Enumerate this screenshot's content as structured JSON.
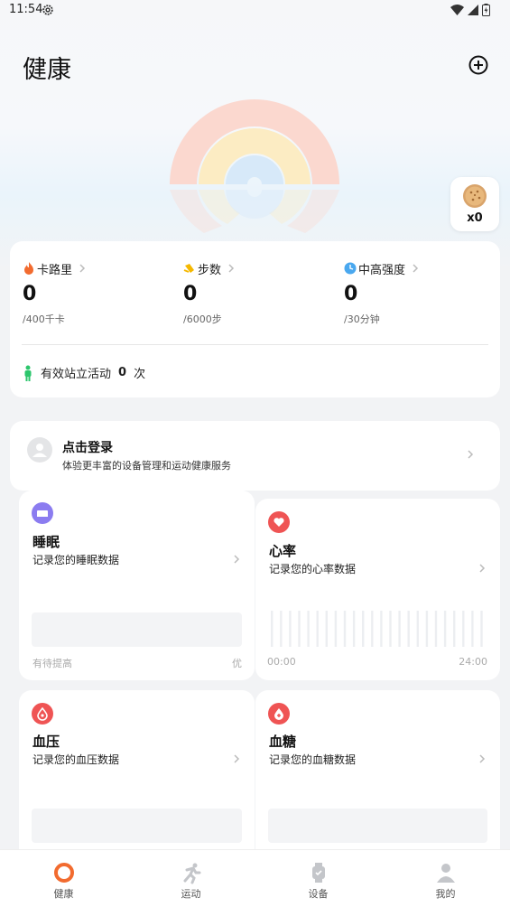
{
  "status_bar": {
    "time": "11:54"
  },
  "header": {
    "title": "健康"
  },
  "badge": {
    "count": "x0"
  },
  "stats": {
    "calories": {
      "label": "卡路里",
      "value": "0",
      "goal": "/400千卡"
    },
    "steps": {
      "label": "步数",
      "value": "0",
      "goal": "/6000步"
    },
    "intensity": {
      "label": "中高强度",
      "value": "0",
      "goal": "/30分钟"
    },
    "stand": {
      "label": "有效站立活动",
      "value": "0",
      "unit": "次"
    }
  },
  "login": {
    "title": "点击登录",
    "subtitle": "体验更丰富的设备管理和运动健康服务"
  },
  "tiles": {
    "sleep": {
      "title": "睡眠",
      "subtitle": "记录您的睡眠数据",
      "foot_left": "有待提高",
      "foot_right": "优"
    },
    "heart": {
      "title": "心率",
      "subtitle": "记录您的心率数据",
      "foot_left": "00:00",
      "foot_right": "24:00"
    },
    "pressure": {
      "title": "血压",
      "subtitle": "记录您的血压数据"
    },
    "sugar": {
      "title": "血糖",
      "subtitle": "记录您的血糖数据"
    }
  },
  "tabbar": {
    "health": "健康",
    "sport": "运动",
    "device": "设备",
    "me": "我的"
  },
  "colors": {
    "accent": "#f26b2f",
    "sleep": "#8b7cf0",
    "heart": "#ef5454",
    "intensity": "#4aa8ef",
    "stand": "#2cc66c"
  }
}
